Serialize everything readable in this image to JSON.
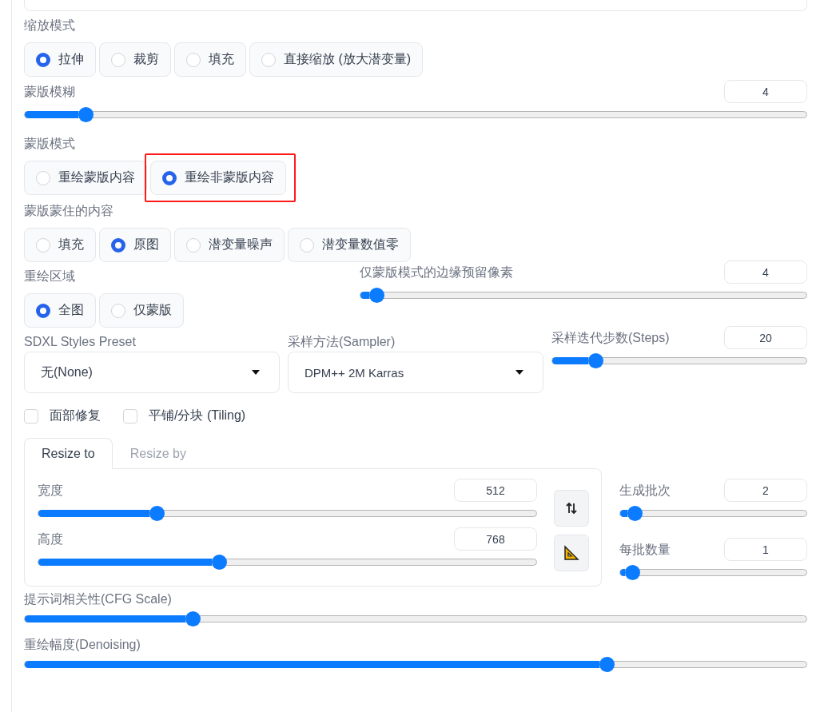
{
  "resize_mode": {
    "label": "缩放模式",
    "options": [
      {
        "label": "拉伸",
        "selected": true,
        "highlighted": false
      },
      {
        "label": "裁剪",
        "selected": false,
        "highlighted": false
      },
      {
        "label": "填充",
        "selected": false,
        "highlighted": false
      },
      {
        "label": "直接缩放 (放大潜变量)",
        "selected": false,
        "highlighted": false
      }
    ]
  },
  "mask_blur": {
    "label": "蒙版模糊",
    "value": "4",
    "level": 0.07
  },
  "mask_mode": {
    "label": "蒙版模式",
    "options": [
      {
        "label": "重绘蒙版内容",
        "selected": false,
        "highlighted": false
      },
      {
        "label": "重绘非蒙版内容",
        "selected": true,
        "highlighted": true
      }
    ]
  },
  "masked_content": {
    "label": "蒙版蒙住的内容",
    "options": [
      {
        "label": "填充",
        "selected": false,
        "highlighted": false
      },
      {
        "label": "原图",
        "selected": true,
        "highlighted": false
      },
      {
        "label": "潜变量噪声",
        "selected": false,
        "highlighted": false
      },
      {
        "label": "潜变量数值零",
        "selected": false,
        "highlighted": false
      }
    ]
  },
  "inpaint_area": {
    "label": "重绘区域",
    "options": [
      {
        "label": "全图",
        "selected": true,
        "highlighted": false
      },
      {
        "label": "仅蒙版",
        "selected": false,
        "highlighted": false
      }
    ]
  },
  "only_masked_padding": {
    "label": "仅蒙版模式的边缘预留像素",
    "value": "4",
    "level": 0.02
  },
  "styles_preset": {
    "label": "SDXL Styles Preset",
    "value": "无(None)"
  },
  "sampler": {
    "label": "采样方法(Sampler)",
    "value": "DPM++ 2M Karras"
  },
  "steps": {
    "label": "采样迭代步数(Steps)",
    "value": "20",
    "level": 0.15
  },
  "checkboxes": [
    {
      "label": "面部修复",
      "checked": false
    },
    {
      "label": "平铺/分块 (Tiling)",
      "checked": false
    }
  ],
  "resize_tabs": [
    {
      "label": "Resize to",
      "selected": true
    },
    {
      "label": "Resize by",
      "selected": false
    }
  ],
  "width": {
    "label": "宽度",
    "value": "512",
    "level": 0.23
  },
  "height": {
    "label": "高度",
    "value": "768",
    "level": 0.36
  },
  "batch_count": {
    "label": "生成批次",
    "value": "2",
    "level": 0.04
  },
  "batch_size": {
    "label": "每批数量",
    "value": "1",
    "level": 0.03
  },
  "cfg_scale": {
    "label": "提示词相关性(CFG Scale)",
    "level": 0.21
  },
  "denoising": {
    "label": "重绘幅度(Denoising)",
    "level": 0.75
  }
}
